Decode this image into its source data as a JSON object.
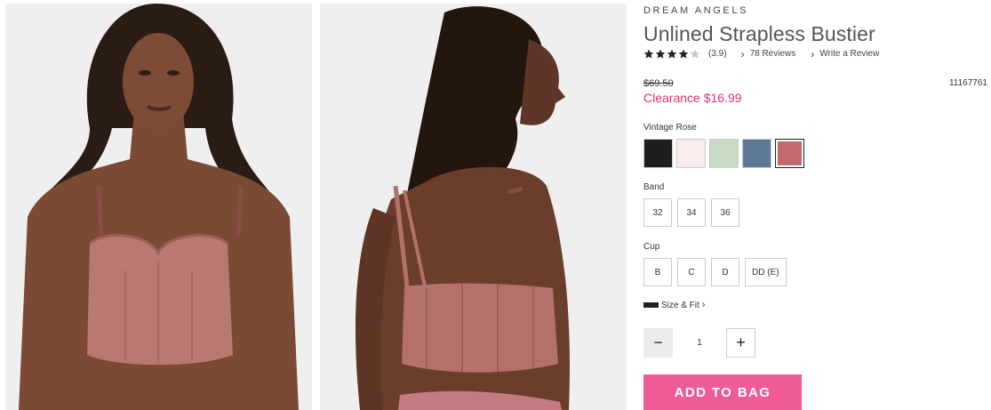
{
  "product": {
    "brand": "DREAM ANGELS",
    "title": "Unlined Strapless Bustier",
    "rating": 3.9,
    "rating_text": "(3.9)",
    "reviews_text": "78 Reviews",
    "write_review_text": "Write a Review",
    "original_price": "$69.50",
    "sale_price": "Clearance $16.99",
    "sku": "11167761",
    "images": [
      {
        "name": "front-view",
        "icon": "model-front-image"
      },
      {
        "name": "back-view",
        "icon": "model-back-image"
      }
    ]
  },
  "colors": {
    "label": "Vintage Rose",
    "selected_index": 4,
    "swatches": [
      {
        "name": "black",
        "hex": "#1e1e1e"
      },
      {
        "name": "blush",
        "hex": "#f9ecec"
      },
      {
        "name": "sage",
        "hex": "#c8dcc4"
      },
      {
        "name": "blue",
        "hex": "#5c7a96"
      },
      {
        "name": "vintage-rose",
        "hex": "#c4686b"
      }
    ]
  },
  "band": {
    "label": "Band",
    "options": [
      "32",
      "34",
      "36"
    ]
  },
  "cup": {
    "label": "Cup",
    "options": [
      "B",
      "C",
      "D",
      "DD (E)"
    ]
  },
  "size_fit": {
    "label": "Size & Fit",
    "icon": "ruler-icon"
  },
  "quantity": {
    "value": "1",
    "minus": "−",
    "plus": "+"
  },
  "cta": {
    "add_to_bag": "ADD TO BAG",
    "color": "#ee5b97"
  },
  "accent": {
    "sale": "#e5306d"
  }
}
